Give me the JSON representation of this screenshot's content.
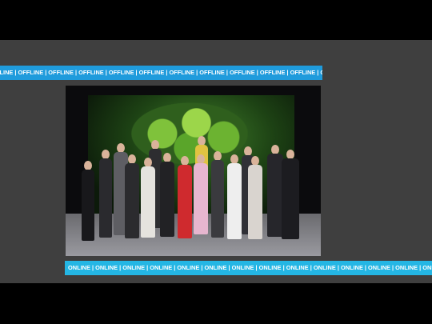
{
  "tickers": {
    "offline_text": "FLINE | OFFLINE | OFFLINE | OFFLINE | OFFLINE | OFFLINE | OFFLINE | OFFLINE | OFFLINE | OFFLINE | OFFLINE |  OFFLINE",
    "online_text": "ONLINE | ONLINE | ONLINE | ONLINE | ONLINE | ONLINE | ONLINE | ONLINE | ONLINE | ONLINE | ONLINE | ONLINE | ONLINE | ONLINE | ONLI"
  },
  "colors": {
    "offline_band": "#1f9bdc",
    "online_band": "#24b6e4",
    "slide_background": "#3f3f3f",
    "frame_background": "#000000"
  }
}
